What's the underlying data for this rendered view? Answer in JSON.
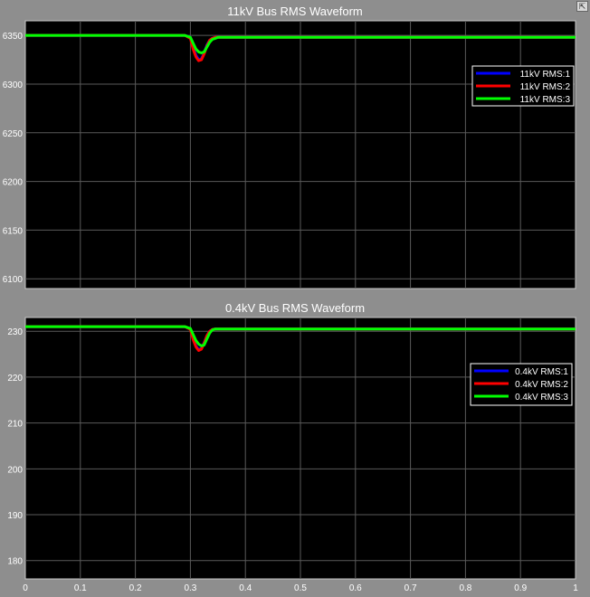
{
  "window": {
    "restore_icon": "restore-icon"
  },
  "chart_data": [
    {
      "type": "line",
      "title": "11kV Bus RMS Waveform",
      "xlabel": "",
      "ylabel": "",
      "xlim": [
        0,
        1
      ],
      "ylim": [
        6090,
        6365
      ],
      "yticks": [
        6100,
        6150,
        6200,
        6250,
        6300,
        6350
      ],
      "xticks": [],
      "grid": true,
      "legend_position": "top-right",
      "series": [
        {
          "name": "11kV RMS:1",
          "color": "#0000ff",
          "x": [
            0,
            0.29,
            0.3,
            0.305,
            0.31,
            0.315,
            0.32,
            0.325,
            0.33,
            0.335,
            0.34,
            0.345,
            0.35,
            1.0
          ],
          "y": [
            6350,
            6350,
            6348,
            6338,
            6330,
            6325,
            6326,
            6332,
            6340,
            6345,
            6347,
            6348,
            6348,
            6348
          ]
        },
        {
          "name": "11kV RMS:2",
          "color": "#ff0000",
          "x": [
            0,
            0.29,
            0.3,
            0.305,
            0.31,
            0.315,
            0.32,
            0.325,
            0.33,
            0.335,
            0.34,
            0.345,
            0.35,
            1.0
          ],
          "y": [
            6350,
            6350,
            6347,
            6336,
            6328,
            6324,
            6325,
            6331,
            6339,
            6345,
            6347,
            6348,
            6348,
            6348
          ]
        },
        {
          "name": "11kV RMS:3",
          "color": "#00ff00",
          "x": [
            0,
            0.29,
            0.3,
            0.305,
            0.31,
            0.315,
            0.32,
            0.325,
            0.33,
            0.335,
            0.34,
            0.345,
            0.35,
            1.0
          ],
          "y": [
            6350,
            6350,
            6348,
            6342,
            6336,
            6333,
            6332,
            6333,
            6338,
            6343,
            6346,
            6347,
            6348,
            6348
          ]
        }
      ]
    },
    {
      "type": "line",
      "title": "0.4kV Bus RMS Waveform",
      "xlabel": "",
      "ylabel": "",
      "xlim": [
        0,
        1
      ],
      "ylim": [
        176,
        233
      ],
      "yticks": [
        180,
        190,
        200,
        210,
        220,
        230
      ],
      "xticks": [
        0,
        0.1,
        0.2,
        0.3,
        0.4,
        0.5,
        0.6,
        0.7,
        0.8,
        0.9,
        1
      ],
      "grid": true,
      "legend_position": "top-right",
      "series": [
        {
          "name": "0.4kV RMS:1",
          "color": "#0000ff",
          "x": [
            0,
            0.29,
            0.3,
            0.305,
            0.31,
            0.315,
            0.32,
            0.325,
            0.33,
            0.335,
            0.34,
            0.345,
            0.35,
            1.0
          ],
          "y": [
            231,
            231,
            230.5,
            228.5,
            226.8,
            226.0,
            226.3,
            227.5,
            229.0,
            230.0,
            230.4,
            230.5,
            230.5,
            230.5
          ]
        },
        {
          "name": "0.4kV RMS:2",
          "color": "#ff0000",
          "x": [
            0,
            0.29,
            0.3,
            0.305,
            0.31,
            0.315,
            0.32,
            0.325,
            0.33,
            0.335,
            0.34,
            0.345,
            0.35,
            1.0
          ],
          "y": [
            231,
            231,
            230.4,
            228.2,
            226.6,
            225.8,
            226.1,
            227.4,
            229.0,
            230.0,
            230.4,
            230.5,
            230.5,
            230.5
          ]
        },
        {
          "name": "0.4kV RMS:3",
          "color": "#00ff00",
          "x": [
            0,
            0.29,
            0.3,
            0.305,
            0.31,
            0.315,
            0.32,
            0.325,
            0.33,
            0.335,
            0.34,
            0.345,
            0.35,
            1.0
          ],
          "y": [
            231,
            231,
            230.6,
            229.3,
            228.0,
            227.2,
            226.8,
            227.0,
            228.3,
            229.6,
            230.3,
            230.5,
            230.5,
            230.5
          ]
        }
      ]
    }
  ]
}
